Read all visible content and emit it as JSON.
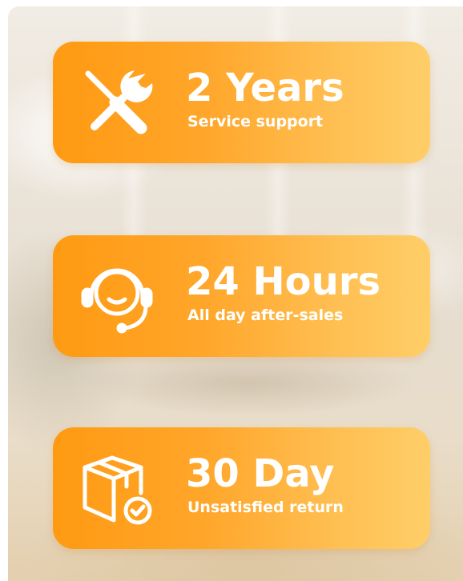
{
  "colors": {
    "card_start": "#ff9a12",
    "card_end": "#ffce68",
    "text": "#ffffff"
  },
  "features": [
    {
      "icon": "tools-icon",
      "title": "2 Years",
      "subtitle": "Service support"
    },
    {
      "icon": "headset-icon",
      "title": "24 Hours",
      "subtitle": "All day after-sales"
    },
    {
      "icon": "package-return-icon",
      "title": "30 Day",
      "subtitle": "Unsatisfied return"
    }
  ]
}
